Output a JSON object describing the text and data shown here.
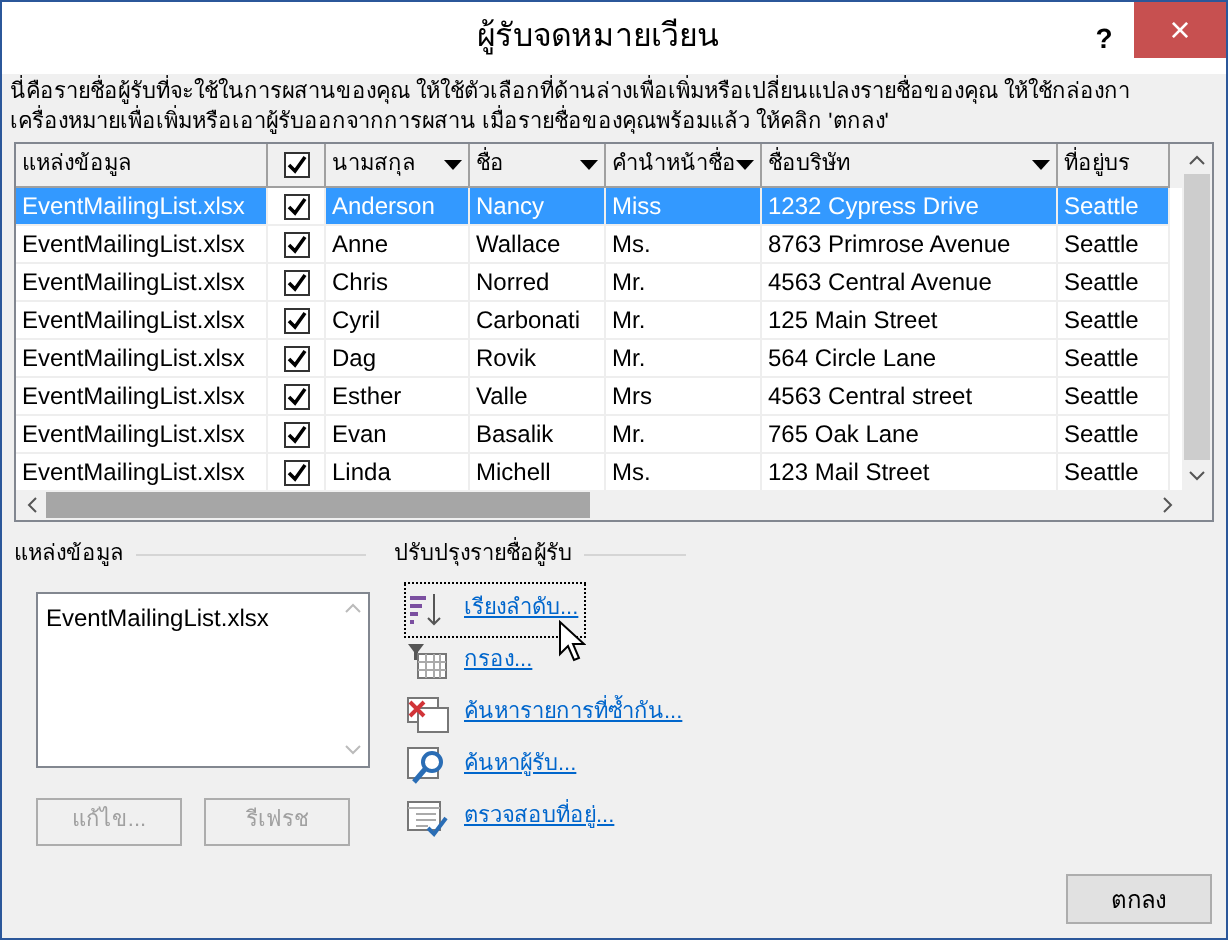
{
  "window": {
    "title": "ผู้รับจดหมายเวียน",
    "help": "?",
    "close": "×"
  },
  "description": "นี่คือรายชื่อผู้รับที่จะใช้ในการผสานของคุณ  ให้ใช้ตัวเลือกที่ด้านล่างเพื่อเพิ่มหรือเปลี่ยนแปลงรายชื่อของคุณ  ให้ใช้กล่องกาเครื่องหมายเพื่อเพิ่มหรือเอาผู้รับออกจากการผสาน  เมื่อรายชื่อของคุณพร้อมแล้ว ให้คลิก 'ตกลง'",
  "table": {
    "select_all": {
      "checked": true
    },
    "columns": [
      {
        "label": "แหล่งข้อมูล",
        "dropdown": false
      },
      {
        "label": "นามสกุล",
        "dropdown": true
      },
      {
        "label": "ชื่อ",
        "dropdown": true
      },
      {
        "label": "คำนำหน้าชื่อ",
        "dropdown": true
      },
      {
        "label": "ชื่อบริษัท",
        "dropdown": true
      },
      {
        "label": "ที่อยู่บร",
        "dropdown": false
      }
    ],
    "rows": [
      {
        "selected": true,
        "included": true,
        "cells": [
          "EventMailingList.xlsx",
          "Anderson",
          "Nancy",
          "Miss",
          "1232 Cypress Drive",
          "Seattle"
        ]
      },
      {
        "selected": false,
        "included": true,
        "cells": [
          "EventMailingList.xlsx",
          "Anne",
          "Wallace",
          "Ms.",
          "8763 Primrose Avenue",
          "Seattle"
        ]
      },
      {
        "selected": false,
        "included": true,
        "cells": [
          "EventMailingList.xlsx",
          "Chris",
          "Norred",
          "Mr.",
          "4563 Central Avenue",
          "Seattle"
        ]
      },
      {
        "selected": false,
        "included": true,
        "cells": [
          "EventMailingList.xlsx",
          "Cyril",
          "Carbonati",
          "Mr.",
          "125 Main Street",
          "Seattle"
        ]
      },
      {
        "selected": false,
        "included": true,
        "cells": [
          "EventMailingList.xlsx",
          "Dag",
          "Rovik",
          "Mr.",
          "564 Circle Lane",
          "Seattle"
        ]
      },
      {
        "selected": false,
        "included": true,
        "cells": [
          "EventMailingList.xlsx",
          "Esther",
          "Valle",
          "Mrs",
          "4563 Central street",
          "Seattle"
        ]
      },
      {
        "selected": false,
        "included": true,
        "cells": [
          "EventMailingList.xlsx",
          "Evan",
          "Basalik",
          "Mr.",
          "765 Oak Lane",
          "Seattle"
        ]
      },
      {
        "selected": false,
        "included": true,
        "cells": [
          "EventMailingList.xlsx",
          "Linda",
          "Michell",
          "Ms.",
          "123 Mail Street",
          "Seattle"
        ]
      }
    ]
  },
  "data_source": {
    "label": "แหล่งข้อมูล",
    "items": [
      "EventMailingList.xlsx"
    ],
    "buttons": [
      {
        "label": "แก้ไข...",
        "disabled": true
      },
      {
        "label": "รีเฟรช",
        "disabled": true
      }
    ]
  },
  "refine": {
    "label": "ปรับปรุงรายชื่อผู้รับ",
    "links": [
      {
        "kind": "sort",
        "label": "เรียงลำดับ...",
        "focused": true
      },
      {
        "kind": "filter",
        "label": "กรอง...",
        "focused": false
      },
      {
        "kind": "duplicates",
        "label": "ค้นหารายการที่ซ้ำกัน...",
        "focused": false
      },
      {
        "kind": "find",
        "label": "ค้นหาผู้รับ...",
        "focused": false
      },
      {
        "kind": "validate",
        "label": "ตรวจสอบที่อยู่...",
        "focused": false
      }
    ]
  },
  "ok_button": "ตกลง"
}
